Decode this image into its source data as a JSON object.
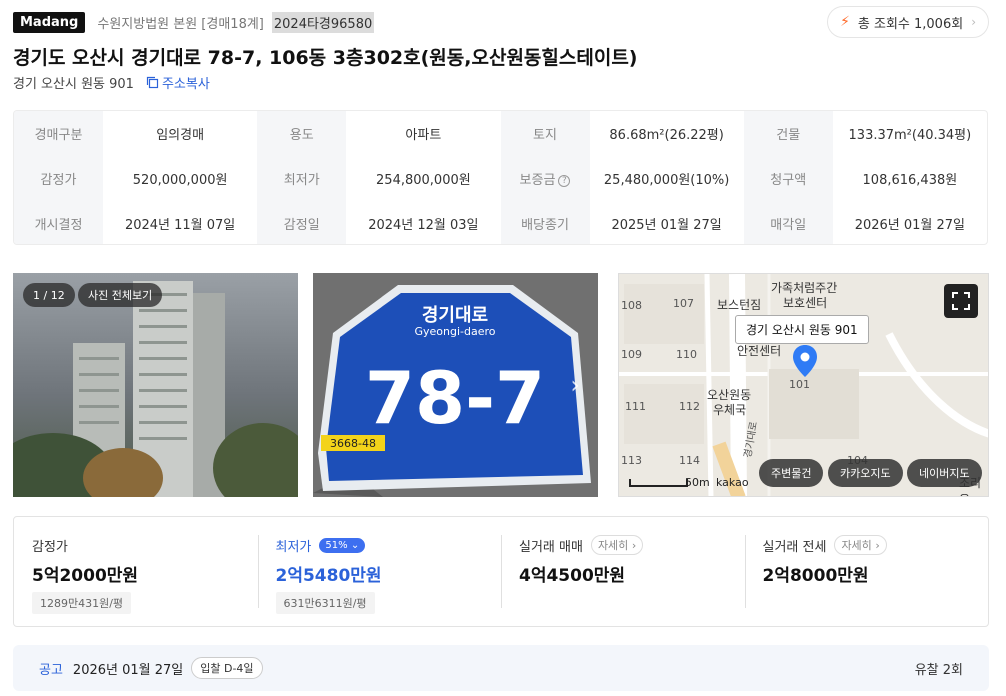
{
  "header": {
    "brand": "Madang",
    "court": "수원지방법원 본원 [경매18계]",
    "case_number": "2024타경96580",
    "views_label": "총 조회수 1,006회"
  },
  "property": {
    "title": "경기도 오산시 경기대로 78-7, 106동 3층302호(원동,오산원동힐스테이트)",
    "lot_address": "경기 오산시 원동 901",
    "copy_label": "주소복사"
  },
  "info_table": [
    [
      {
        "label": "경매구분",
        "value": "임의경매"
      },
      {
        "label": "용도",
        "value": "아파트"
      },
      {
        "label": "토지",
        "value": "86.68m²(26.22평)"
      },
      {
        "label": "건물",
        "value": "133.37m²(40.34평)"
      }
    ],
    [
      {
        "label": "감정가",
        "value": "520,000,000원"
      },
      {
        "label": "최저가",
        "value": "254,800,000원"
      },
      {
        "label": "보증금",
        "value": "25,480,000원(10%)"
      },
      {
        "label": "청구액",
        "value": "108,616,438원"
      }
    ],
    [
      {
        "label": "개시결정",
        "value": "2024년 11월 07일"
      },
      {
        "label": "감정일",
        "value": "2024년 12월 03일"
      },
      {
        "label": "배당종기",
        "value": "2025년 01월 27일"
      },
      {
        "label": "매각일",
        "value": "2026년 01월 27일"
      }
    ]
  ],
  "gallery": {
    "counter": "1 / 12",
    "view_all": "사진 전체보기",
    "sign_title": "경기대로",
    "sign_roman": "Gyeongi-daero",
    "sign_number": "78-7",
    "sign_code": "3668-48"
  },
  "map": {
    "location_label": "경기 오산시 원동 901",
    "places": [
      "가족처럼주간",
      "보호센터",
      "보스턴짐",
      "안전센터",
      "오산원동",
      "우체국",
      "경기대로",
      "조리울"
    ],
    "block_numbers": [
      "108",
      "107",
      "109",
      "110",
      "111",
      "112",
      "113",
      "114",
      "101",
      "104"
    ],
    "scale": "50m",
    "provider": "kakao",
    "buttons": [
      "주변물건",
      "카카오지도",
      "네이버지도"
    ]
  },
  "prices": {
    "appraisal": {
      "label": "감정가",
      "value": "5억2000만원",
      "per_pyeong": "1289만431원/평"
    },
    "minimum": {
      "label": "최저가",
      "badge": "51%",
      "value": "2억5480만원",
      "per_pyeong": "631만6311원/평"
    },
    "sale": {
      "label": "실거래 매매",
      "more": "자세히",
      "value": "4억4500만원"
    },
    "jeonse": {
      "label": "실거래 전세",
      "more": "자세히",
      "value": "2억8000만원"
    }
  },
  "notice": {
    "tag": "공고",
    "date": "2026년 01월 27일",
    "dday": "입찰 D-4일",
    "fail_count": "유찰 2회"
  },
  "colors": {
    "accent": "#2b62d9",
    "badge": "#3d6ff0",
    "bolt": "#ff6a2a"
  }
}
